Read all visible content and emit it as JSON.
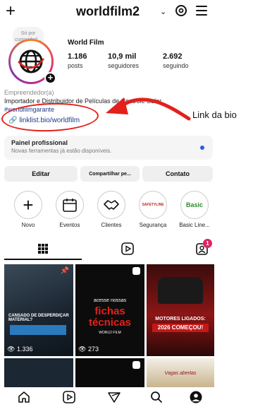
{
  "topbar": {
    "username": "worldfilm2",
    "chevron": "⌄",
    "add_icon": "plus-icon",
    "threads_icon": "threads-icon",
    "menu_icon": "hamburger-menu-icon"
  },
  "note": {
    "text": "Só por curiosidad..."
  },
  "profile": {
    "name": "World Film",
    "stats": [
      {
        "value": "1.186",
        "label": "posts"
      },
      {
        "value": "10,9 mil",
        "label": "seguidores"
      },
      {
        "value": "2.692",
        "label": "seguindo"
      }
    ],
    "category": "Empreendedor(a)",
    "bio": "Importador e Distribuidor de Películas de Controle Solar.",
    "hashtag": "#worldfilmgarante",
    "link": "linklist.bio/worldfilm"
  },
  "annotation": {
    "callout": "Link da bio",
    "accent": "#e3201b"
  },
  "panel": {
    "title": "Painel profissional",
    "subtitle": "Novas ferramentas já estão disponíveis."
  },
  "buttons": {
    "edit": "Editar",
    "share": "Compartilhar pe...",
    "contact": "Contato"
  },
  "highlights": [
    {
      "label": "Novo",
      "icon": "plus-icon"
    },
    {
      "label": "Eventos",
      "icon": "calendar-icon"
    },
    {
      "label": "Clientes",
      "icon": "handshake-icon"
    },
    {
      "label": "Segurança",
      "icon": "safetyline-logo"
    },
    {
      "label": "Basic Line...",
      "icon": "basic-logo"
    }
  ],
  "highlight_logos": {
    "safety": "SAFETYLINE",
    "basic": "Basic"
  },
  "tabs": {
    "badge": "1"
  },
  "grid": {
    "tile1": {
      "caption": "CANSADO DE DESPERDIÇAR MATERIAL?",
      "views": "1.336"
    },
    "tile2": {
      "line1": "acesse nossas",
      "line2": "fichas",
      "line3": "técnicas",
      "brand": "WORLD FILM",
      "views": "273"
    },
    "tile3": {
      "line1": "MOTORES LIGADOS:",
      "line2": "2026 COMEÇOU!"
    },
    "tile6": {
      "caption": "Vagas abertas"
    }
  },
  "colors": {
    "link": "#1c3a8a",
    "dot": "#2c5ce8",
    "badge": "#e0245e"
  }
}
